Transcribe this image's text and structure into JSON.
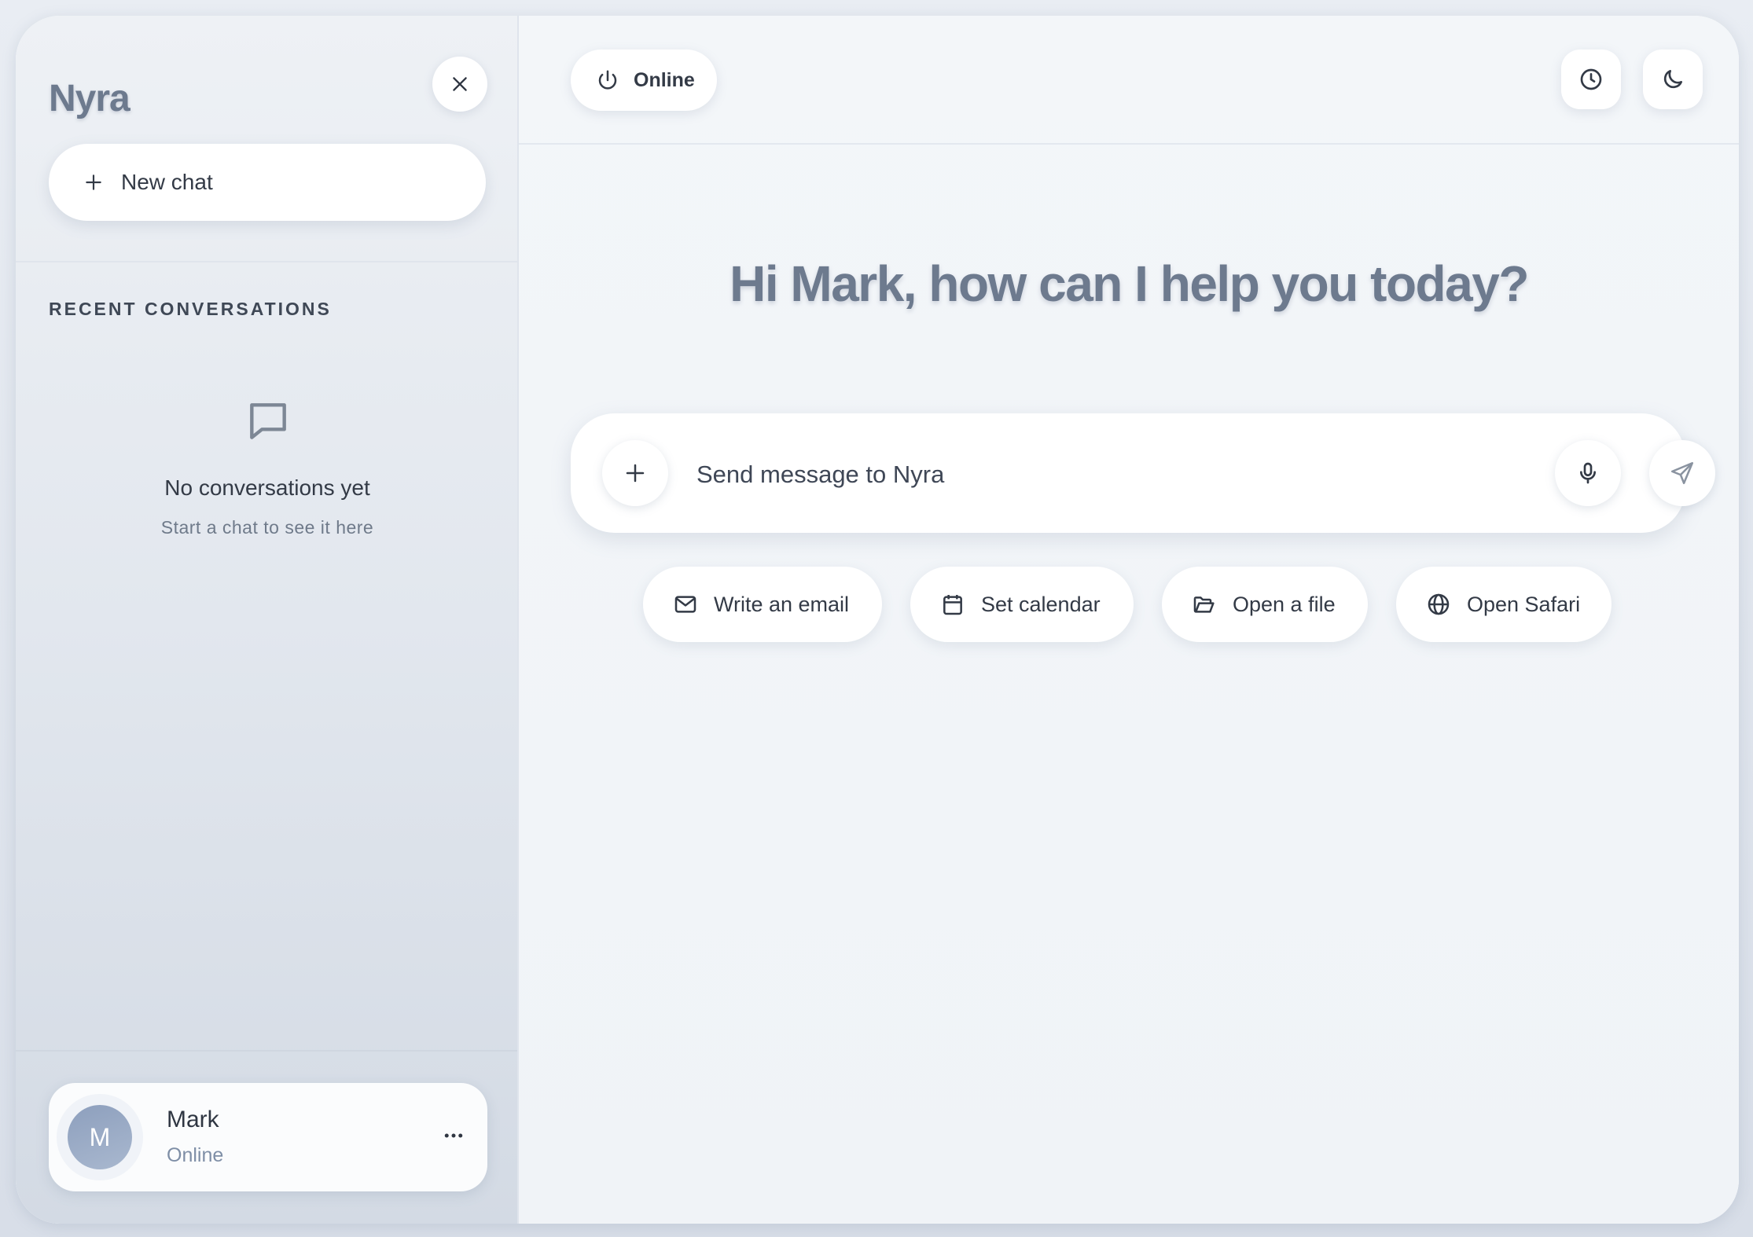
{
  "sidebar": {
    "brand": "Nyra",
    "new_chat_label": "New chat",
    "recent_title": "RECENT CONVERSATIONS",
    "empty_title": "No conversations yet",
    "empty_subtitle": "Start a chat to see it here",
    "user": {
      "initial": "M",
      "name": "Mark",
      "status": "Online"
    }
  },
  "topbar": {
    "status_label": "Online",
    "history_icon": "clock-icon",
    "theme_icon": "moon-icon"
  },
  "main": {
    "greeting": "Hi Mark, how can I help you today?",
    "composer": {
      "placeholder": "Send message to Nyra"
    },
    "suggestions": [
      {
        "label": "Write an email",
        "icon": "mail-icon"
      },
      {
        "label": "Set calendar",
        "icon": "calendar-icon"
      },
      {
        "label": "Open a file",
        "icon": "folder-icon"
      },
      {
        "label": "Open Safari",
        "icon": "globe-icon"
      }
    ]
  },
  "colors": {
    "heading": "#6d7a8e",
    "text": "#333a46",
    "muted": "#6f7a8a",
    "avatar": "#8d9fbd"
  }
}
